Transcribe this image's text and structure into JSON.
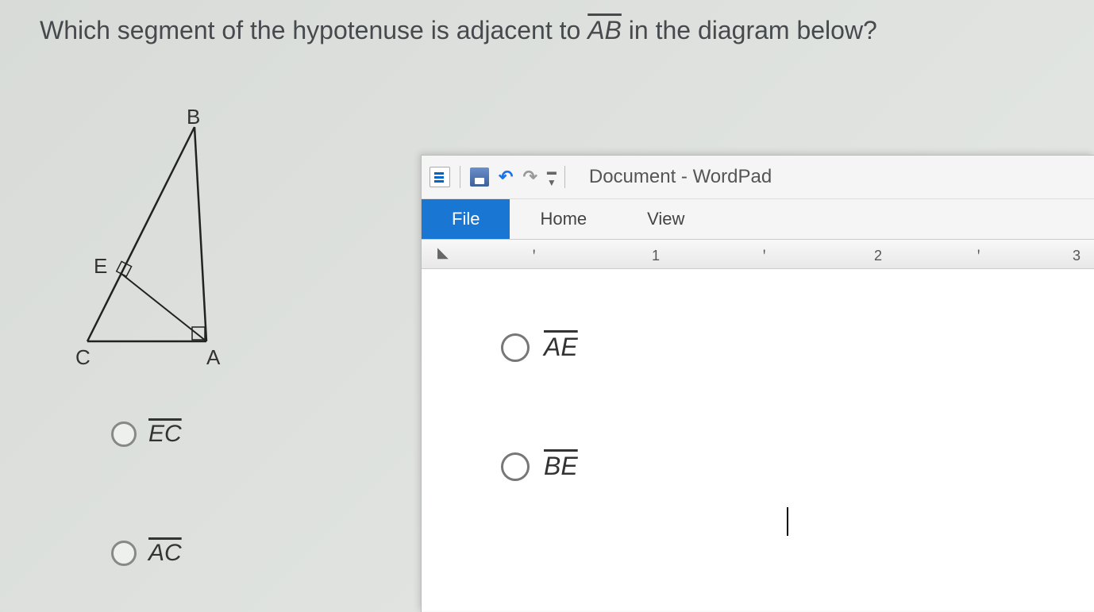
{
  "question": {
    "text_before": "Which segment of the hypotenuse is adjacent to ",
    "segment": "AB",
    "text_after": " in the diagram below?"
  },
  "diagram": {
    "vertices": {
      "B": "B",
      "E": "E",
      "C": "C",
      "A": "A"
    }
  },
  "options": {
    "left": [
      {
        "label": "EC"
      },
      {
        "label": "AC"
      }
    ],
    "right": [
      {
        "label": "AE"
      },
      {
        "label": "BE"
      }
    ]
  },
  "wordpad": {
    "title": "Document - WordPad",
    "tabs": {
      "file": "File",
      "home": "Home",
      "view": "View"
    },
    "ruler": {
      "n1": "1",
      "n2": "2",
      "n3": "3"
    }
  }
}
